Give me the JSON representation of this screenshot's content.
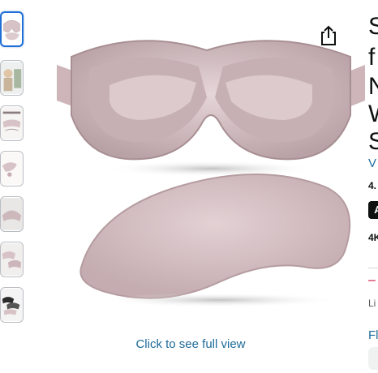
{
  "product": {
    "title_lines": [
      "S",
      "f",
      "N",
      "W",
      "S"
    ],
    "store_link": "V",
    "rating": "4.",
    "badge": "A",
    "bought": "4K",
    "price_dash": "–",
    "list_label": "Li",
    "more_link": "Fl"
  },
  "gallery": {
    "full_view_label": "Click to see full view",
    "thumbnail_count": 7,
    "active_thumbnail": 1
  },
  "colors": {
    "mask": "#d7c3c6",
    "link": "#1d6b9a",
    "active_border": "#1f6fd6"
  }
}
